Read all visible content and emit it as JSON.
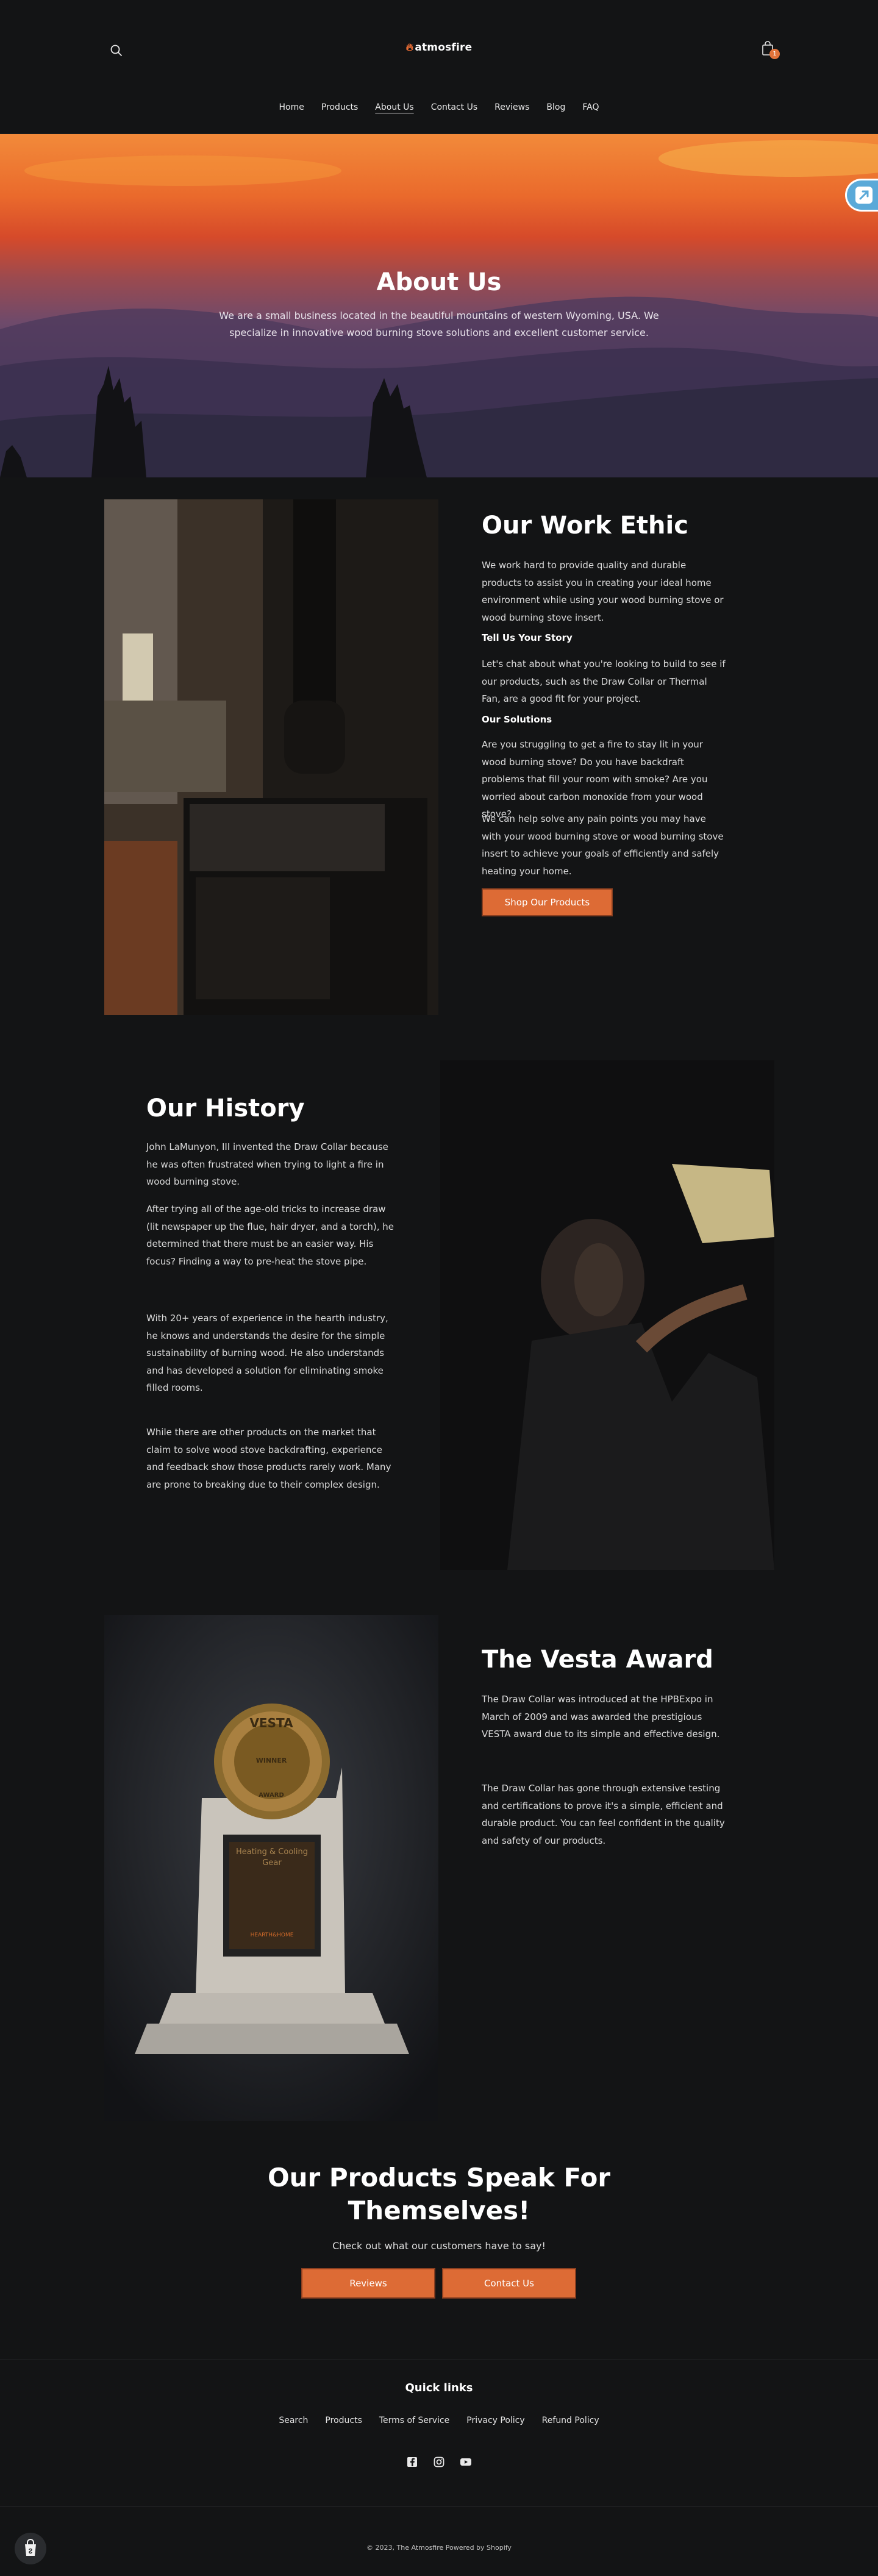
{
  "header": {
    "logo_text": "atmosfire",
    "cart_count": "1",
    "nav": [
      "Home",
      "Products",
      "About Us",
      "Contact Us",
      "Reviews",
      "Blog",
      "FAQ"
    ],
    "active_nav": "About Us"
  },
  "hero": {
    "title": "About Us",
    "text": "We are a small business located in the beautiful mountains of western Wyoming, USA. We specialize in innovative wood burning stove solutions and excellent customer service."
  },
  "work_ethic": {
    "title": "Our Work Ethic",
    "p1": "We work hard to provide quality and durable products to assist you in creating your ideal home environment while using your wood burning stove or wood burning stove insert.",
    "label1": "Tell Us Your Story",
    "p2": "Let's chat about what you're looking to build to see if our products, such as the Draw Collar or Thermal Fan, are a good fit for your project.",
    "label2": "Our Solutions",
    "p3": "Are you struggling to get a fire to stay lit in your wood burning stove? Do you have backdraft problems that fill your room with smoke? Are you worried about carbon monoxide from your wood stove?",
    "p4": "We can help solve any pain points you may have with your wood burning stove or wood burning stove insert to achieve your goals of efficiently and safely heating your home.",
    "button": "Shop Our Products"
  },
  "history": {
    "title": "Our History",
    "p1": "John LaMunyon, III invented the Draw Collar because he was often frustrated when trying to light a fire in wood burning stove.",
    "p2": "After trying all of the age-old tricks to increase draw (lit newspaper up the flue, hair dryer, and a torch), he determined that there must be an easier way. His focus? Finding a way to pre-heat the stove pipe.",
    "p3": "With 20+ years of experience in the hearth industry, he knows and understands the desire for the simple sustainability of burning wood. He also understands and has developed a solution for eliminating smoke filled rooms.",
    "p4": "While there are other products on the market that claim to solve wood stove backdrafting, experience and feedback show those products rarely work. Many are prone to breaking due to their complex design."
  },
  "vesta": {
    "title": "The Vesta Award",
    "p1": "The Draw Collar was introduced at the HPBExpo in March of 2009 and was awarded the prestigious VESTA award due to its simple and effective design.",
    "p2": "The Draw Collar has gone through extensive testing and certifications to prove it's a simple, efficient and durable product.  You can feel confident in the quality and safety of our products.",
    "medal_top": "VESTA",
    "medal_mid": "WINNER",
    "medal_bottom": "AWARD",
    "plaque": "Heating & Cooling Gear",
    "plaque_brand": "HEARTH&HOME"
  },
  "cta": {
    "title": "Our Products Speak For Themselves!",
    "subtitle": "Check out what our customers have to say!",
    "btn1": "Reviews",
    "btn2": "Contact Us"
  },
  "footer": {
    "quick_links_title": "Quick links",
    "links": [
      "Search",
      "Products",
      "Terms of Service",
      "Privacy Policy",
      "Refund Policy"
    ],
    "copyright": "© 2023, The Atmosfire Powered by Shopify"
  }
}
